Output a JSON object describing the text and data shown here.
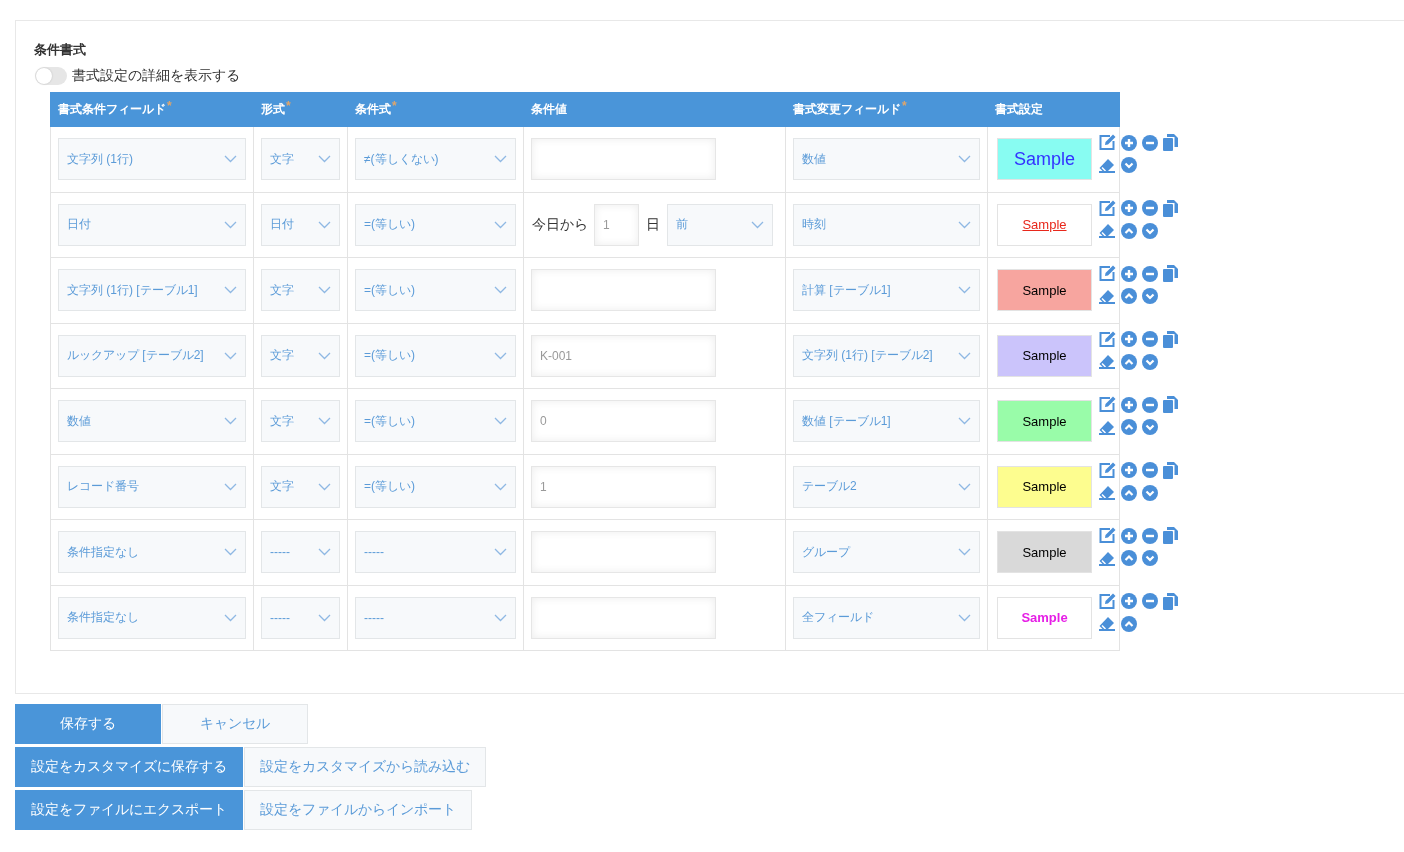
{
  "section": {
    "title": "条件書式",
    "toggle": {
      "label": "書式設定の詳細を表示する",
      "on": false
    }
  },
  "table": {
    "columns": [
      {
        "label": "書式条件フィールド",
        "required_mark": "*"
      },
      {
        "label": "形式",
        "required_mark": "*"
      },
      {
        "label": "条件式",
        "required_mark": "*"
      },
      {
        "label": "条件値"
      },
      {
        "label": "書式変更フィールド",
        "required_mark": "*"
      },
      {
        "label": "書式設定"
      }
    ],
    "rows": [
      {
        "field": "文字列 (1行)",
        "format": "文字",
        "condition": "≠(等しくない)",
        "value": {
          "kind": "text"
        },
        "target": "数値",
        "sample": {
          "text": "Sample",
          "color": "#3333ff",
          "large": true,
          "underline": false,
          "bold": false,
          "fill": {
            "color": "#88fcf2"
          }
        },
        "can_move_up": false,
        "can_move_down": true
      },
      {
        "field": "日付",
        "format": "日付",
        "condition": "=(等しい)",
        "value": {
          "kind": "date",
          "prefix": "今日から",
          "number": "1",
          "unit": "日",
          "direction": "前"
        },
        "target": "時刻",
        "sample": {
          "text": "Sample",
          "color": "#e8281c",
          "large": false,
          "underline": true,
          "bold": false,
          "fill": {
            "color": "#ffffff"
          }
        },
        "can_move_up": true,
        "can_move_down": true
      },
      {
        "field": "文字列 (1行) [テーブル1]",
        "format": "文字",
        "condition": "=(等しい)",
        "value": {
          "kind": "text"
        },
        "target": "計算 [テーブル1]",
        "sample": {
          "text": "Sample",
          "color": "#000000",
          "large": false,
          "underline": false,
          "bold": false,
          "fill": {
            "color": "#f7a59f"
          }
        },
        "can_move_up": true,
        "can_move_down": true
      },
      {
        "field": "ルックアップ [テーブル2]",
        "format": "文字",
        "condition": "=(等しい)",
        "value": {
          "kind": "text",
          "text": "K-001"
        },
        "target": "文字列 (1行) [テーブル2]",
        "sample": {
          "text": "Sample",
          "color": "#000000",
          "large": false,
          "underline": false,
          "bold": false,
          "fill": {
            "color": "#cbc4fb"
          }
        },
        "can_move_up": true,
        "can_move_down": true
      },
      {
        "field": "数値",
        "format": "文字",
        "condition": "=(等しい)",
        "value": {
          "kind": "text",
          "text": "0"
        },
        "target": "数値 [テーブル1]",
        "sample": {
          "text": "Sample",
          "color": "#000000",
          "large": false,
          "underline": false,
          "bold": false,
          "fill": {
            "color": "#99fca9"
          }
        },
        "can_move_up": true,
        "can_move_down": true
      },
      {
        "field": "レコード番号",
        "format": "文字",
        "condition": "=(等しい)",
        "value": {
          "kind": "text",
          "text": "1"
        },
        "target": "テーブル2",
        "sample": {
          "text": "Sample",
          "color": "#000000",
          "large": false,
          "underline": false,
          "bold": false,
          "fill": {
            "color": "#fdfd8f"
          }
        },
        "can_move_up": true,
        "can_move_down": true
      },
      {
        "field": "条件指定なし",
        "format": "-----",
        "condition": "-----",
        "value": {
          "kind": "text"
        },
        "target": "グループ",
        "sample": {
          "text": "Sample",
          "color": "#000000",
          "large": false,
          "underline": false,
          "bold": false,
          "fill": {
            "color": "#d9d9d9"
          }
        },
        "can_move_up": true,
        "can_move_down": true
      },
      {
        "field": "条件指定なし",
        "format": "-----",
        "condition": "-----",
        "value": {
          "kind": "text"
        },
        "target": "全フィールド",
        "sample": {
          "text": "Sample",
          "color": "#e61ee6",
          "large": false,
          "underline": false,
          "bold": true,
          "fill": {
            "color": "#ffffff"
          }
        },
        "can_move_up": true,
        "can_move_down": false
      }
    ]
  },
  "button_rows": [
    [
      {
        "label": "保存する",
        "kind": "primary"
      },
      {
        "label": "キャンセル",
        "kind": "secondary"
      }
    ],
    [
      {
        "label": "設定をカスタマイズに保存する",
        "kind": "primary"
      },
      {
        "label": "設定をカスタマイズから読み込む",
        "kind": "secondary"
      }
    ],
    [
      {
        "label": "設定をファイルにエクスポート",
        "kind": "primary"
      },
      {
        "label": "設定をファイルからインポート",
        "kind": "secondary"
      }
    ]
  ]
}
